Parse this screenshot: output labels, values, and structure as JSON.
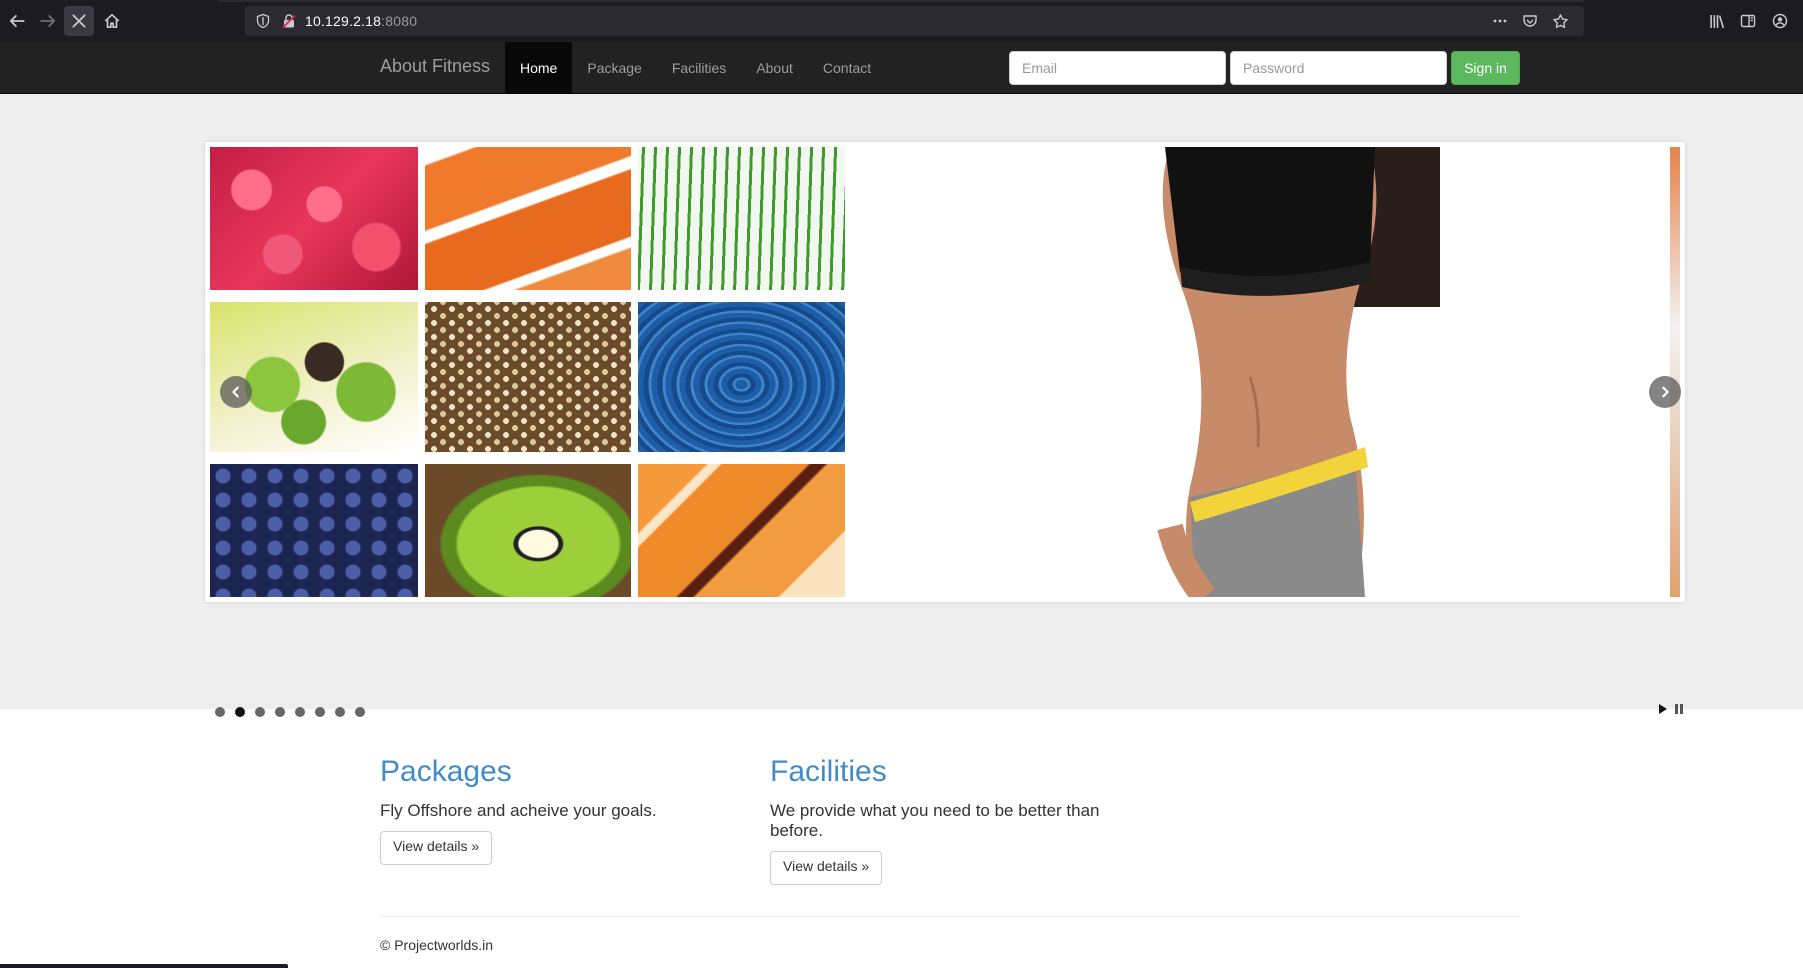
{
  "browser": {
    "url_host": "10.129.2.18",
    "url_port": ":8080"
  },
  "site": {
    "brand": "About Fitness",
    "menu": [
      {
        "label": "Home",
        "active": true
      },
      {
        "label": "Package",
        "active": false
      },
      {
        "label": "Facilities",
        "active": false
      },
      {
        "label": "About",
        "active": false
      },
      {
        "label": "Contact",
        "active": false
      }
    ],
    "signin": {
      "email_placeholder": "Email",
      "password_placeholder": "Password",
      "button_label": "Sign in"
    }
  },
  "slider": {
    "slide_count": 8,
    "active_slide": 2
  },
  "sections": {
    "packages": {
      "title": "Packages",
      "text": "Fly Offshore and acheive your goals.",
      "button": "View details »"
    },
    "facilities": {
      "title": "Facilities",
      "text": "We provide what you need to be better than before.",
      "button": "View details »"
    }
  },
  "footer": {
    "text": "© Projectworlds.in"
  },
  "colors": {
    "navbar_bg": "#222222",
    "link_blue": "#428bca",
    "success": "#5cb85c",
    "jumbotron_bg": "#eeeeee"
  }
}
